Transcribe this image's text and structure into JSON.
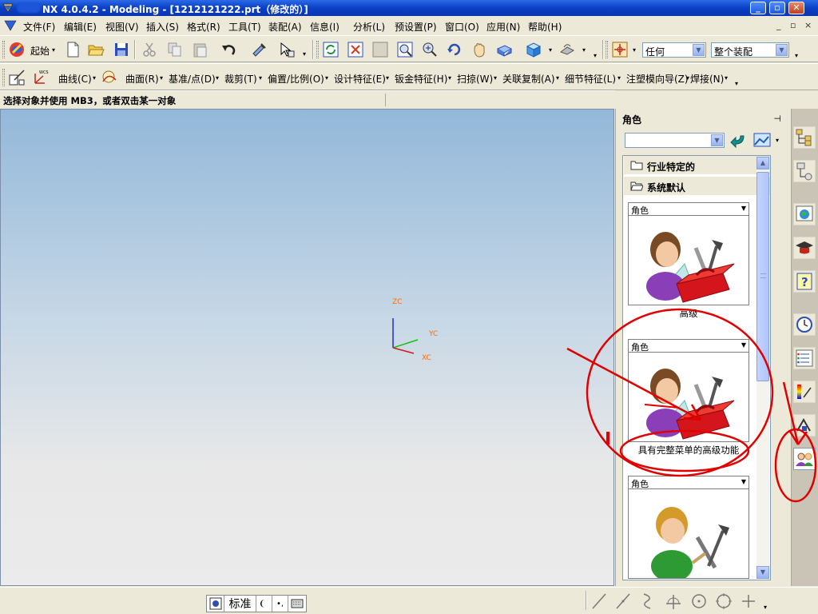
{
  "window": {
    "title": "NX 4.0.4.2 - Modeling - [1212121222.prt（修改的）]",
    "controls": {
      "minimize": "_",
      "maximize": "▫",
      "close": "✕"
    }
  },
  "menubar": {
    "items": [
      "文件(F)",
      "编辑(E)",
      "视图(V)",
      "插入(S)",
      "格式(R)",
      "工具(T)",
      "装配(A)",
      "信息(I)",
      "分析(L)",
      "预设置(P)",
      "窗口(O)",
      "应用(N)",
      "帮助(H)"
    ],
    "doc_controls": [
      "_",
      "▫",
      "×"
    ]
  },
  "toolbar1": {
    "start_label": "起始",
    "filter_combo": "任何",
    "scope_combo": "整个装配"
  },
  "toolbar2": {
    "items": [
      "曲线(C)",
      "曲面(R)",
      "基准/点(D)",
      "裁剪(T)",
      "偏置/比例(O)",
      "设计特征(E)",
      "钣金特征(H)",
      "扫掠(W)",
      "关联复制(A)",
      "细节特征(L)",
      "注塑模向导(Z)",
      "焊接(N)"
    ]
  },
  "hintbar": {
    "text": "选择对象并使用 MB3，或者双击某一对象"
  },
  "viewport": {
    "axes": {
      "z": "ZC",
      "y": "YC",
      "x": "XC"
    }
  },
  "role_panel": {
    "title": "角色",
    "pin": "⊣",
    "folders": [
      "行业特定的",
      "系统默认"
    ],
    "cards": [
      {
        "header": "角色",
        "caption": "高级"
      },
      {
        "header": "角色",
        "caption": "具有完整菜单的高级功能"
      },
      {
        "header": "角色",
        "caption": ""
      }
    ]
  },
  "statusbar": {
    "ime_mode": "标准"
  },
  "colors": {
    "titlebar": "#0a3fc6",
    "annotation": "#e00000",
    "axis_label": "#ff6c00"
  }
}
